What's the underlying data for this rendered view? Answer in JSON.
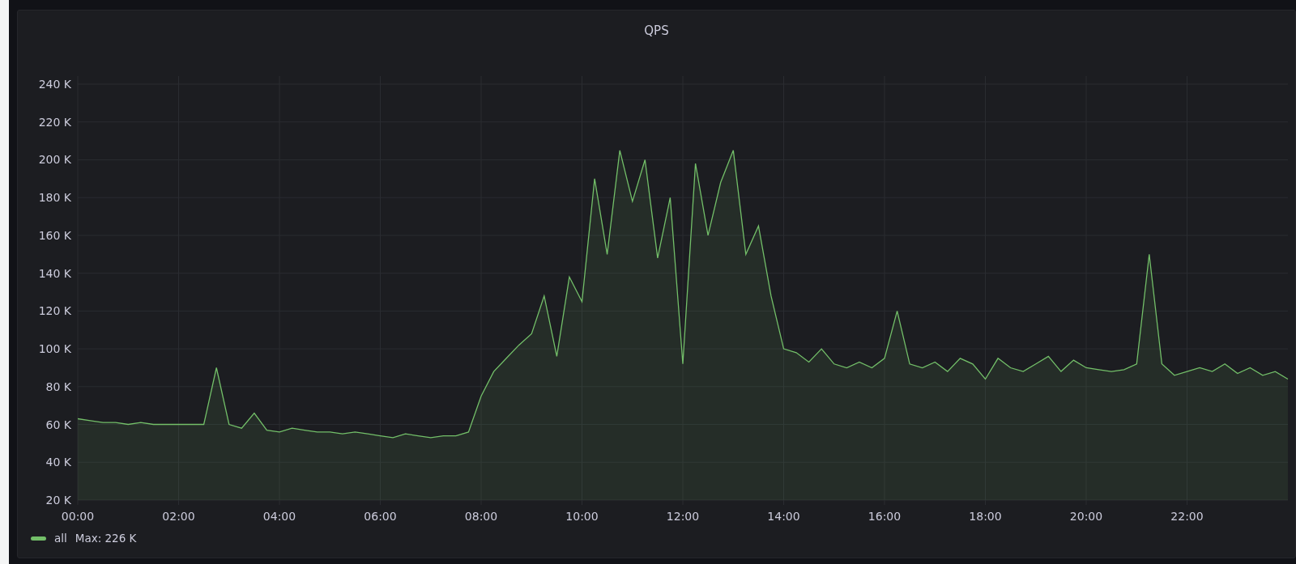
{
  "panel": {
    "legend_stat": "Max: 226 K",
    "chart_data": {
      "type": "area",
      "title": "QPS",
      "grid": true,
      "xlim": [
        0,
        24
      ],
      "ylim": [
        20,
        240
      ],
      "xticks": [
        {
          "value": 0,
          "label": "00:00"
        },
        {
          "value": 2,
          "label": "02:00"
        },
        {
          "value": 4,
          "label": "04:00"
        },
        {
          "value": 6,
          "label": "06:00"
        },
        {
          "value": 8,
          "label": "08:00"
        },
        {
          "value": 10,
          "label": "10:00"
        },
        {
          "value": 12,
          "label": "12:00"
        },
        {
          "value": 14,
          "label": "14:00"
        },
        {
          "value": 16,
          "label": "16:00"
        },
        {
          "value": 18,
          "label": "18:00"
        },
        {
          "value": 20,
          "label": "20:00"
        },
        {
          "value": 22,
          "label": "22:00"
        }
      ],
      "yticks": [
        {
          "value": 20,
          "label": "20 K"
        },
        {
          "value": 40,
          "label": "40 K"
        },
        {
          "value": 60,
          "label": "60 K"
        },
        {
          "value": 80,
          "label": "80 K"
        },
        {
          "value": 100,
          "label": "100 K"
        },
        {
          "value": 120,
          "label": "120 K"
        },
        {
          "value": 140,
          "label": "140 K"
        },
        {
          "value": 160,
          "label": "160 K"
        },
        {
          "value": 180,
          "label": "180 K"
        },
        {
          "value": 200,
          "label": "200 K"
        },
        {
          "value": 220,
          "label": "220 K"
        },
        {
          "value": 240,
          "label": "240 K"
        }
      ],
      "x": [
        0,
        0.25,
        0.5,
        0.75,
        1,
        1.25,
        1.5,
        1.75,
        2,
        2.25,
        2.5,
        2.75,
        3,
        3.25,
        3.5,
        3.75,
        4,
        4.25,
        4.5,
        4.75,
        5,
        5.25,
        5.5,
        5.75,
        6,
        6.25,
        6.5,
        6.75,
        7,
        7.25,
        7.5,
        7.75,
        8,
        8.25,
        8.5,
        8.75,
        9,
        9.25,
        9.5,
        9.75,
        10,
        10.25,
        10.5,
        10.75,
        11,
        11.25,
        11.5,
        11.75,
        12,
        12.25,
        12.5,
        12.75,
        13,
        13.25,
        13.5,
        13.75,
        14,
        14.25,
        14.5,
        14.75,
        15,
        15.25,
        15.5,
        15.75,
        16,
        16.25,
        16.5,
        16.75,
        17,
        17.25,
        17.5,
        17.75,
        18,
        18.25,
        18.5,
        18.75,
        19,
        19.25,
        19.5,
        19.75,
        20,
        20.25,
        20.5,
        20.75,
        21,
        21.25,
        21.5,
        21.75,
        22,
        22.25,
        22.5,
        22.75,
        23,
        23.25,
        23.5,
        23.75,
        24
      ],
      "series": [
        {
          "name": "all",
          "color": "#73bf69",
          "values": [
            63,
            62,
            61,
            61,
            60,
            61,
            60,
            60,
            60,
            60,
            60,
            90,
            60,
            58,
            66,
            57,
            56,
            58,
            57,
            56,
            56,
            55,
            56,
            55,
            54,
            53,
            55,
            54,
            53,
            54,
            54,
            56,
            75,
            88,
            95,
            102,
            108,
            128,
            96,
            138,
            125,
            190,
            150,
            205,
            178,
            200,
            148,
            180,
            92,
            198,
            160,
            188,
            205,
            150,
            165,
            128,
            100,
            98,
            93,
            100,
            92,
            90,
            93,
            90,
            95,
            120,
            92,
            90,
            93,
            88,
            95,
            92,
            84,
            95,
            90,
            88,
            92,
            96,
            88,
            94,
            90,
            89,
            88,
            89,
            92,
            150,
            92,
            86,
            88,
            90,
            88,
            92,
            87,
            90,
            86,
            88,
            84
          ]
        }
      ]
    }
  }
}
